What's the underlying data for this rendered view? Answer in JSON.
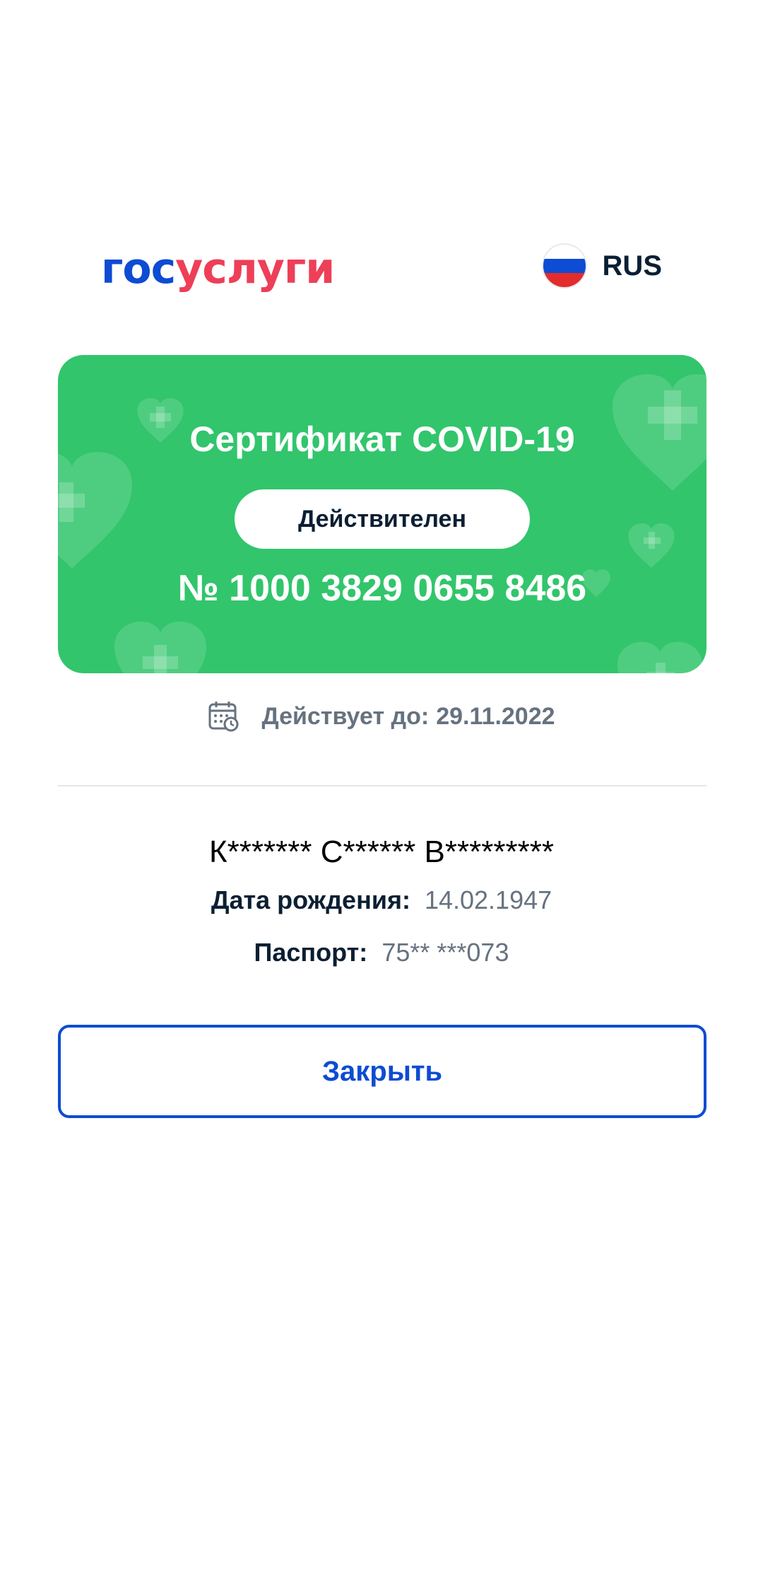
{
  "header": {
    "logo_part1": "гос",
    "logo_part2": "услуги",
    "language_label": "RUS",
    "flag_colors": [
      "#ffffff",
      "#0d4cd3",
      "#e32c2c"
    ]
  },
  "certificate": {
    "title": "Сертификат COVID-19",
    "status": "Действителен",
    "number": "№ 1000 3829 0655 8486",
    "background_color": "#32c56c"
  },
  "validity": {
    "label": "Действует до:",
    "date": "29.11.2022",
    "icon": "calendar-icon"
  },
  "person": {
    "name": "К******* С****** В*********",
    "birth_label": "Дата рождения:",
    "birth_value": "14.02.1947",
    "passport_label": "Паспорт:",
    "passport_value": "75** ***073"
  },
  "actions": {
    "close_label": "Закрыть"
  },
  "colors": {
    "accent": "#0d4cd3",
    "brand_red": "#ee3f58",
    "text_primary": "#0b1f33",
    "text_secondary": "#66727f"
  }
}
